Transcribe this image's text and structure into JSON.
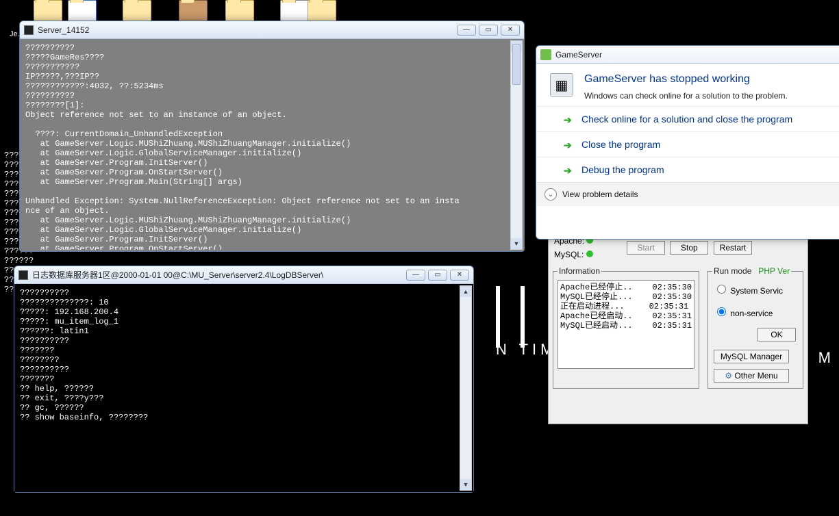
{
  "desktop": {
    "icon_labels": [
      "Je..."
    ]
  },
  "wallpaper": {
    "right_text": "N TIME",
    "left_text": "M"
  },
  "bg_console": "????????????????????????????????\n????????????????????????????????\n????????????????????????????????\n????????????????????????????????\n?????????\n?????????\n?????????\n?????????\n?????????\n?????????\n??????\n??????\n??????\n??????\n?????????",
  "server_win": {
    "title": "Server_14152",
    "text": "??????????\n?????GameRes????\n???????????\nIP?????,???IP??\n????????????:4032, ??:5234ms\n??????????\n????????[1]:\nObject reference not set to an instance of an object.\n\n  ????: CurrentDomain_UnhandledException\n   at GameServer.Logic.MUShiZhuang.MUShiZhuangManager.initialize()\n   at GameServer.Logic.GlobalServiceManager.initialize()\n   at GameServer.Program.InitServer()\n   at GameServer.Program.OnStartServer()\n   at GameServer.Program.Main(String[] args)\n\nUnhandled Exception: System.NullReferenceException: Object reference not set to an insta\nnce of an object.\n   at GameServer.Logic.MUShiZhuang.MUShiZhuangManager.initialize()\n   at GameServer.Logic.GlobalServiceManager.initialize()\n   at GameServer.Program.InitServer()\n   at GameServer.Program.OnStartServer()\n   at GameServer.Program.Main(String[] args)"
  },
  "logdb_win": {
    "title": "日志数据库服务器1区@2000-01-01 00@C:\\MU_Server\\server2.4\\LogDBServer\\",
    "text": "??????????\n??????????????: 10\n?????: 192.168.200.4\n?????: mu_item_log_1\n??????: latin1\n??????????\n???????\n????????\n??????????\n???????\n?? help, ??????\n?? exit, ????y???\n?? gc, ??????\n?? show baseinfo, ????????"
  },
  "error_dialog": {
    "app_name": "GameServer",
    "heading": "GameServer has stopped working",
    "sub": "Windows can check online for a solution to the problem.",
    "opt1": "Check online for a solution and close the program",
    "opt2": "Close the program",
    "opt3": "Debug the program",
    "details": "View problem details"
  },
  "panel": {
    "apache_label": "Apache:",
    "mysql_label": "MySQL:",
    "start": "Start",
    "stop": "Stop",
    "restart": "Restart",
    "info_legend": "Information",
    "run_legend": "Run mode",
    "php_ver": "PHP Ver",
    "opt_service": "System Servic",
    "opt_nonservice": "non-service",
    "ok": "OK",
    "mysql_mgr": "MySQL Manager",
    "other_menu": "Other Menu",
    "info_text": "Apache已经停止..    02:35:30\nMySQL已经停止...    02:35:30\n正在启动进程...     02:35:31\nApache已经启动..    02:35:31\nMySQL已经启动...    02:35:31"
  }
}
